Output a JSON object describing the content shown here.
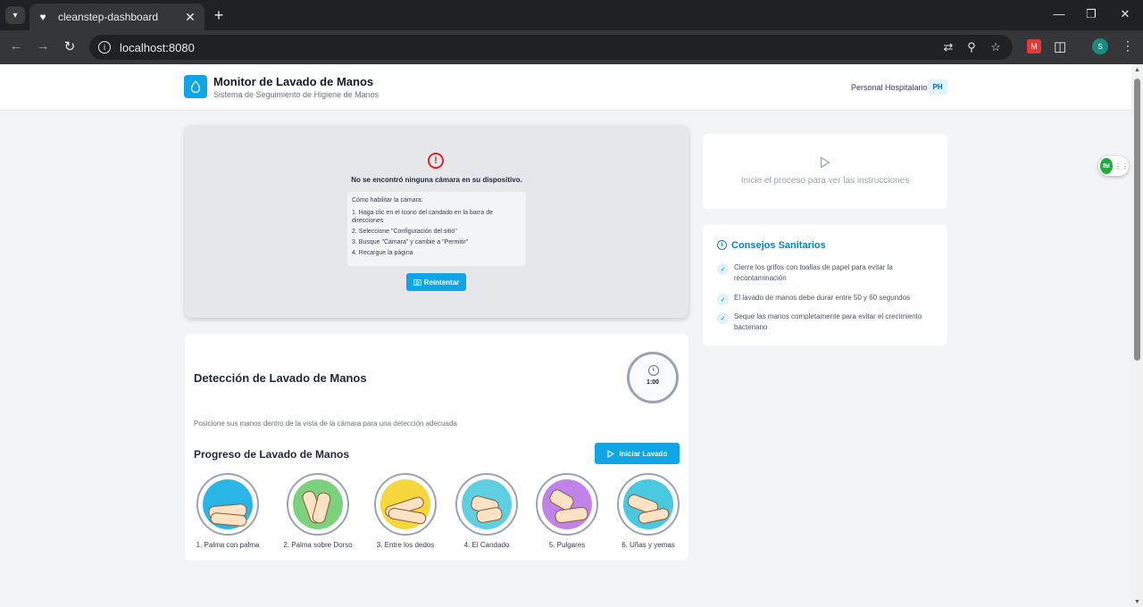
{
  "browser": {
    "tab_title": "cleanstep-dashboard",
    "url": "localhost:8080",
    "profile_initial": "S"
  },
  "header": {
    "title": "Monitor de Lavado de Manos",
    "subtitle": "Sistema de Seguimiento de Higiene de Manos",
    "role": "Personal Hospitalario",
    "role_badge": "PH"
  },
  "camera": {
    "error_message": "No se encontró ninguna cámara en su dispositivo.",
    "instructions_title": "Cómo habilitar la cámara:",
    "steps": [
      "1. Haga clic en el ícono del candado en la barra de direcciones",
      "2. Seleccione \"Configuración del sitio\"",
      "3. Busque \"Cámara\" y cambie a \"Permitir\"",
      "4. Recargue la página"
    ],
    "retry_label": "Reintentar"
  },
  "detection": {
    "title": "Detección de Lavado de Manos",
    "timer": "1:00",
    "hint": "Posicione sus manos dentro de la vista de la cámara para una detección adecuada",
    "progress_title": "Progreso de Lavado de Manos",
    "start_label": "Iniciar Lavado",
    "steps": [
      {
        "label": "1. Palma con palma",
        "bg": "#29b6e6"
      },
      {
        "label": "2. Palma sobre Dorso",
        "bg": "#7cd17c"
      },
      {
        "label": "3. Entre los dedos",
        "bg": "#f5d63d"
      },
      {
        "label": "4. El Candado",
        "bg": "#5ecfe0"
      },
      {
        "label": "5. Pulgares",
        "bg": "#c084e8"
      },
      {
        "label": "6. Uñas y yemas",
        "bg": "#48c9e0"
      }
    ]
  },
  "instructions_panel": {
    "text": "Inicie el proceso para ver las instrucciones"
  },
  "tips": {
    "title": "Consejos Sanitarios",
    "items": [
      "Cierre los grifos con toallas de papel para evitar la recontaminación",
      "El lavado de manos debe durar entre 50 y 60 segundos",
      "Seque las manos completamente para evitar el crecimiento bacteriano"
    ]
  },
  "colors": {
    "accent": "#0ea5e9",
    "error": "#dc2626"
  }
}
